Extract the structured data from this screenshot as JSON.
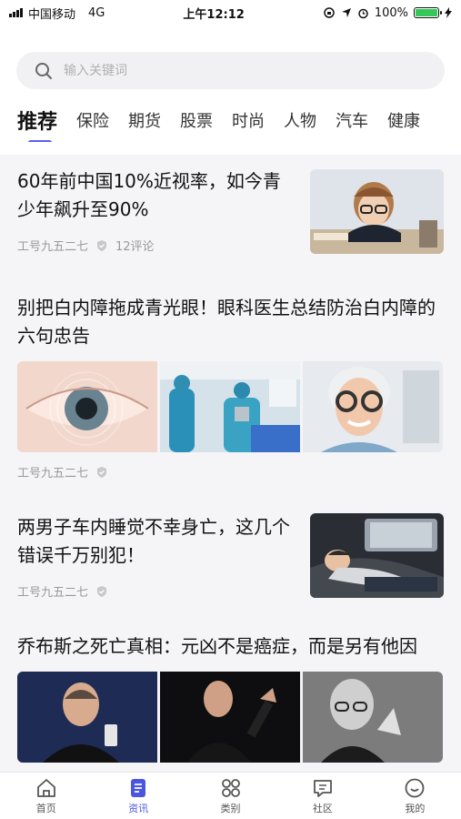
{
  "status_bar": {
    "carrier": "中国移动",
    "network": "4G",
    "time": "上午12:12",
    "battery": "100%"
  },
  "search": {
    "placeholder": "输入关键词"
  },
  "tabs": [
    {
      "label": "推荐",
      "active": true
    },
    {
      "label": "保险"
    },
    {
      "label": "期货"
    },
    {
      "label": "股票"
    },
    {
      "label": "时尚"
    },
    {
      "label": "人物"
    },
    {
      "label": "汽车"
    },
    {
      "label": "健康"
    }
  ],
  "articles": [
    {
      "title": "60年前中国10%近视率，如今青少年飙升至90%",
      "author": "工号九五二七",
      "comments": "12评论"
    },
    {
      "title": "别把白内障拖成青光眼！眼科医生总结防治白内障的六句忠告",
      "author": "工号九五二七"
    },
    {
      "title": "两男子车内睡觉不幸身亡，这几个错误千万别犯！",
      "author": "工号九五二七"
    },
    {
      "title": "乔布斯之死亡真相：元凶不是癌症，而是另有他因"
    }
  ],
  "bottom_nav": [
    {
      "label": "首页",
      "icon": "home-icon"
    },
    {
      "label": "资讯",
      "icon": "news-icon",
      "active": true
    },
    {
      "label": "类别",
      "icon": "category-icon"
    },
    {
      "label": "社区",
      "icon": "community-icon"
    },
    {
      "label": "我的",
      "icon": "profile-icon"
    }
  ],
  "colors": {
    "accent": "#5b64e6",
    "battery": "#34c759"
  }
}
